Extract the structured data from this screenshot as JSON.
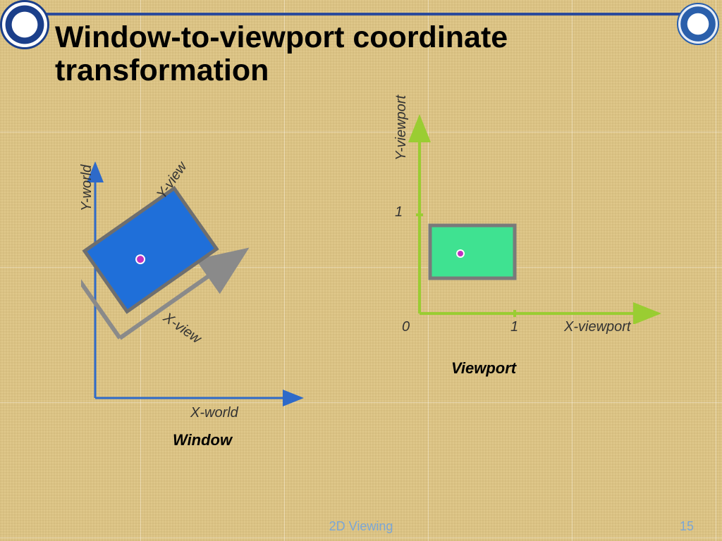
{
  "title": "Window-to-viewport coordinate transformation",
  "left": {
    "caption": "Window",
    "x_axis": "X-world",
    "y_axis": "Y-world",
    "local_x": "X-view",
    "local_y": "Y-view"
  },
  "right": {
    "caption": "Viewport",
    "x_axis": "X-viewport",
    "y_axis": "Y-viewport",
    "origin_tick": "0",
    "x_tick": "1",
    "y_tick": "1"
  },
  "footer": {
    "center": "2D Viewing",
    "page": "15"
  },
  "colors": {
    "world_axis": "#2E6AC9",
    "view_axis": "#8A8A8A",
    "window_fill": "#1F6FD9",
    "viewport_axis": "#9ACD32",
    "viewport_fill": "#3FE291",
    "dot": "#C030C0"
  }
}
